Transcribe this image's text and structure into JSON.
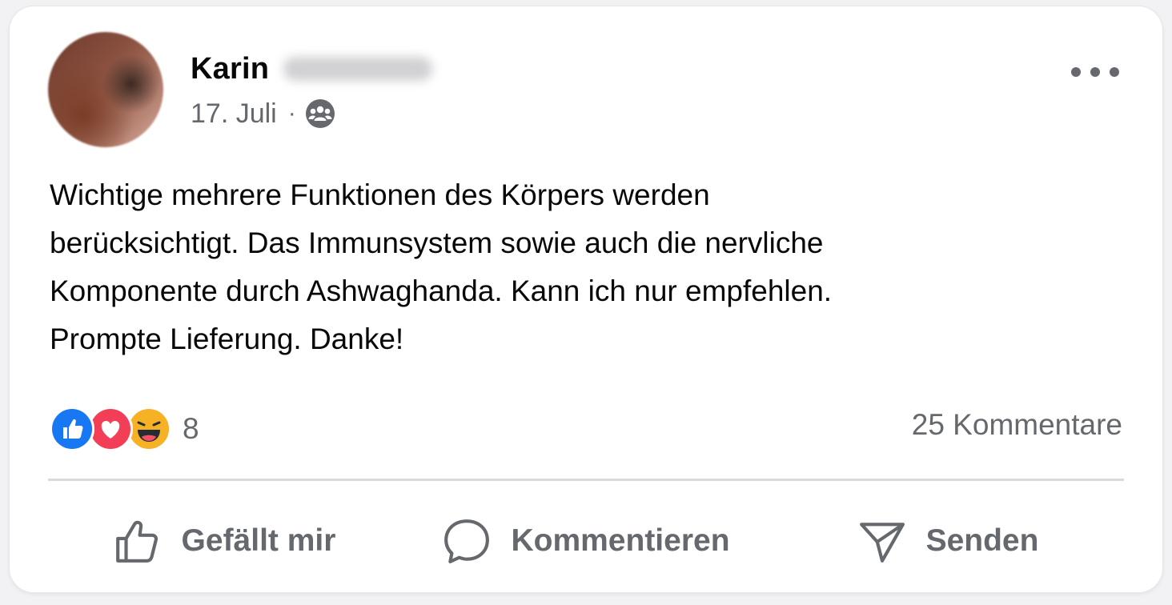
{
  "post": {
    "author": {
      "first_name": "Karin"
    },
    "date": "17. Juli",
    "separator": "·",
    "audience_icon": "group-icon",
    "text_lines": [
      "Wichtige mehrere Funktionen des Körpers werden",
      "berücksichtigt. Das Immunsystem sowie auch die nervliche",
      "Komponente durch Ashwaghanda. Kann ich nur empfehlen.",
      "Prompte Lieferung. Danke!"
    ]
  },
  "engagement": {
    "reactions": [
      "like",
      "love",
      "haha"
    ],
    "reaction_count": "8",
    "comment_count": "25 Kommentare"
  },
  "actions": {
    "like_label": "Gefällt mir",
    "comment_label": "Kommentieren",
    "send_label": "Senden"
  },
  "colors": {
    "like_blue": "#1877f2",
    "love_red": "#f33e58",
    "haha_yellow": "#f7b125",
    "secondary_text": "#65686c",
    "primary_text": "#080809"
  }
}
